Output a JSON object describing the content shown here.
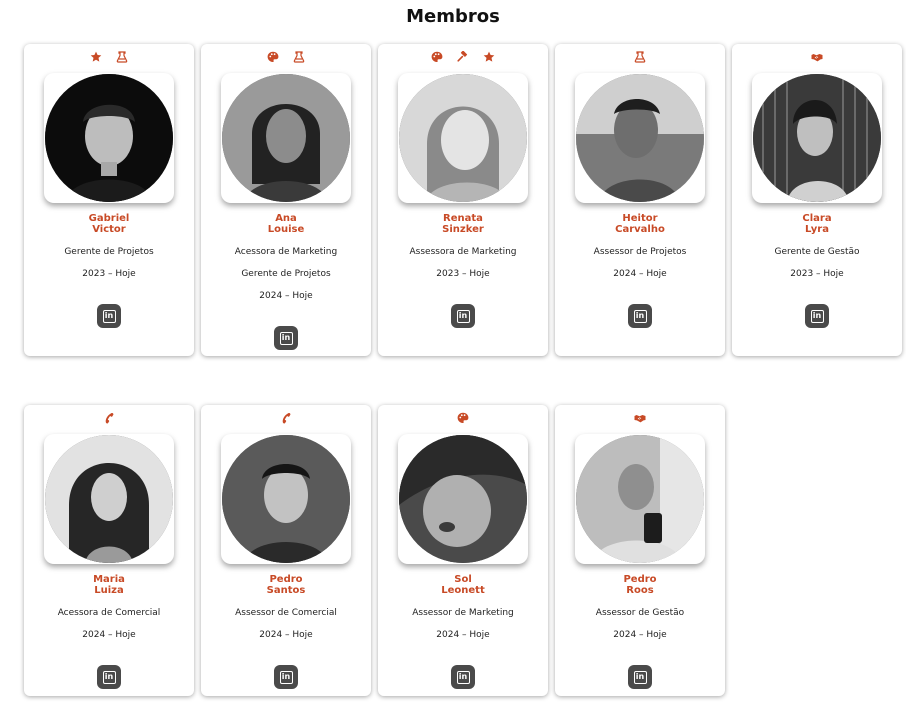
{
  "page": {
    "title": "Membros"
  },
  "colors": {
    "accent": "#c84a26",
    "button": "#4a4a4a"
  },
  "members": [
    {
      "name": "Gabriel\nVictor",
      "roles": [
        "Gerente de Projetos"
      ],
      "period": "2023 – Hoje",
      "icons": [
        "star-icon",
        "flask-icon"
      ],
      "linkedin": "in"
    },
    {
      "name": "Ana\nLouise",
      "roles": [
        "Acessora de Marketing",
        "Gerente de Projetos"
      ],
      "period": "2024 – Hoje",
      "icons": [
        "palette-icon",
        "flask-icon"
      ],
      "linkedin": "in"
    },
    {
      "name": "Renata\nSinzker",
      "roles": [
        "Assessora de Marketing"
      ],
      "period": "2023 – Hoje",
      "icons": [
        "palette-icon",
        "gavel-icon",
        "star-icon"
      ],
      "linkedin": "in"
    },
    {
      "name": "Heitor\nCarvalho",
      "roles": [
        "Assessor de Projetos"
      ],
      "period": "2024 – Hoje",
      "icons": [
        "flask-icon"
      ],
      "linkedin": "in"
    },
    {
      "name": "Clara\nLyra",
      "roles": [
        "Gerente de Gestão"
      ],
      "period": "2023 – Hoje",
      "icons": [
        "handshake-icon"
      ],
      "linkedin": "in"
    },
    {
      "name": "Maria\nLuiza",
      "roles": [
        "Acessora de Comercial"
      ],
      "period": "2024 – Hoje",
      "icons": [
        "phone-icon"
      ],
      "linkedin": "in"
    },
    {
      "name": "Pedro\nSantos",
      "roles": [
        "Assessor de Comercial"
      ],
      "period": "2024 – Hoje",
      "icons": [
        "phone-icon"
      ],
      "linkedin": "in"
    },
    {
      "name": "Sol\nLeonett",
      "roles": [
        "Assessor de Marketing"
      ],
      "period": "2024 – Hoje",
      "icons": [
        "palette-icon"
      ],
      "linkedin": "in"
    },
    {
      "name": "Pedro\nRoos",
      "roles": [
        "Assessor de Gestão"
      ],
      "period": "2024 – Hoje",
      "icons": [
        "handshake-icon"
      ],
      "linkedin": "in"
    }
  ]
}
